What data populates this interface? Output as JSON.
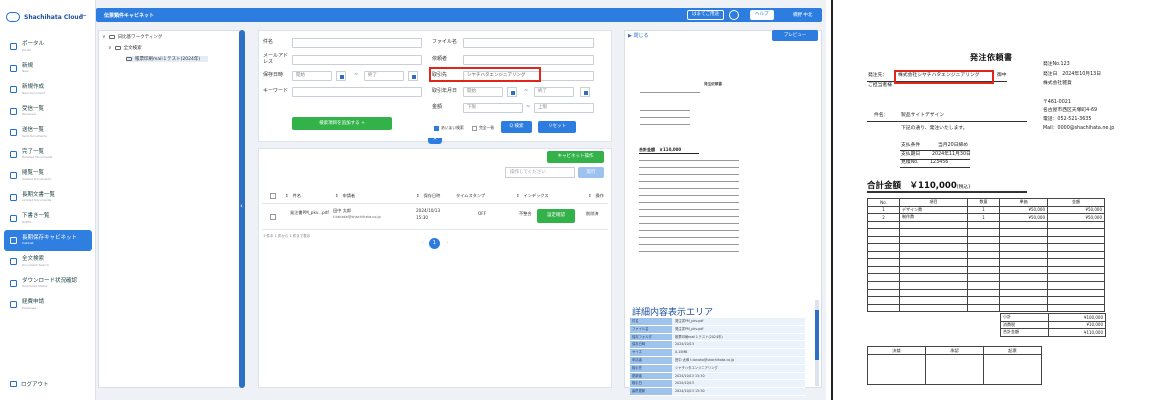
{
  "app": {
    "brand": "Shachihata Cloud",
    "topbar_title": "伝票類件キャビネット",
    "topbar_buttons": [
      "はまてご用途",
      "ヘルプ"
    ],
    "user": "橋野 中北"
  },
  "sidebar": {
    "items": [
      {
        "label": "ポータル",
        "sub": "Portal"
      },
      {
        "label": "新規",
        "sub": "New"
      },
      {
        "label": "新規作成",
        "sub": "New Document"
      },
      {
        "label": "受信一覧",
        "sub": "Received"
      },
      {
        "label": "送信一覧",
        "sub": "Sent Documents"
      },
      {
        "label": "完了一覧",
        "sub": "Finished Documents"
      },
      {
        "label": "閲覧一覧",
        "sub": "Viewed Documents"
      },
      {
        "label": "長期文書一覧",
        "sub": "Limited Documents"
      },
      {
        "label": "下書き一覧",
        "sub": "Drafts"
      },
      {
        "label": "長期保存キャビネット",
        "sub": "Cabinet"
      },
      {
        "label": "全文検索",
        "sub": "Document Search"
      },
      {
        "label": "ダウンロード状況確認",
        "sub": "Download Status"
      },
      {
        "label": "経費申請",
        "sub": "Expenses"
      }
    ],
    "logout": "ログアウト"
  },
  "tree": {
    "root": "日比基ワークティング",
    "folder": "全文検索",
    "selected": "帳票印刷mail１テスト(2024年)"
  },
  "search_form": {
    "name_label": "件名",
    "filename_label": "ファイル名",
    "email_label": "メールアドレス",
    "sender_label": "依頼者",
    "saved_date_label": "保存日時",
    "date_from": "開始",
    "date_to": "終了",
    "partner_label": "取引先",
    "partner_value": "シヤチハタエンジニアリング",
    "keyword_label": "キーワード",
    "txn_date_label": "取引年月日",
    "amount_label": "金額",
    "amount_min": "下限",
    "amount_max": "上限",
    "add_condition": "検索項目を追加する +",
    "chk_exact": "あいまい検索",
    "chk_all": "完全一致",
    "search_btn": "Q 検索",
    "reset_btn": "リセット"
  },
  "results": {
    "bulk_btn": "キャビネット操作",
    "select_placeholder": "操作してください",
    "exec_btn": "実行",
    "headers": [
      "件名",
      "申請者",
      "保存日時",
      "タイムスタンプ",
      "インデックス",
      "操作"
    ],
    "rows": [
      {
        "name": "発注書PM_pkv...pdf",
        "applicant": "田中 太郎",
        "applicant_email": "t.tanaka@shachihata.co.jp",
        "date": "2024/10/13",
        "time": "15:30",
        "timestamp": "OFF",
        "index_status": "不整合",
        "index_btn": "設定確認",
        "action": "削除済"
      }
    ],
    "pager_note": "1 件中 1 件から 1 件まで表示",
    "page": "1"
  },
  "preview": {
    "close": "閉じる",
    "preview_btn": "プレビュー",
    "detail_title": "詳細内容表示エリア",
    "mini_title": "発注依頼書",
    "mini_total": "合計金額　￥110,000",
    "details": [
      {
        "k": "件名",
        "v": "発注書PM_pkv.pdf"
      },
      {
        "k": "ファイル名",
        "v": "発注書PM_pkv.pdf"
      },
      {
        "k": "保存フォルダ",
        "v": "帳票印刷mail１テスト(2024年)"
      },
      {
        "k": "保存日時",
        "v": "2024/10/13"
      },
      {
        "k": "サイズ",
        "v": "0.15MB"
      },
      {
        "k": "申請者",
        "v": "田中 太郎 t.tanaka@shachihata.co.jp"
      },
      {
        "k": "取引先",
        "v": "シヤチハタエンジニアリング"
      },
      {
        "k": "更新者",
        "v": "2024/10/13 15:30"
      },
      {
        "k": "取引日",
        "v": "2024/10/13"
      },
      {
        "k": "最終更新",
        "v": "2024/10/13 15:30"
      }
    ]
  },
  "document": {
    "title": "発注依頼書",
    "to_label": "発注先：",
    "to_name": "株式会社シヤチハタエンジニアリング",
    "to_suffix": "御中",
    "responsible": "ご担当者様",
    "order_no": "発注No.123",
    "order_date": "発注日　2024年10月13日",
    "company": "株式会社雑貨",
    "zip": "〒461-0021",
    "address": "名古屋市西区天塚町4-69",
    "tel": "電話：052-521-3635",
    "mail": "Mail：0000@shachihata.ne.jp",
    "subject_label": "件名：",
    "subject": "製品サイトデザイン",
    "intro": "下記の通り、発注いたします。",
    "pay_terms_label": "支払条件",
    "pay_terms": "当月20日締め",
    "pay_due_label": "支払期日",
    "pay_due": "2024年11月30日",
    "estimate_label": "見積No.",
    "estimate_no": "123456",
    "total_label": "合計金額",
    "total_amount": "￥110,000",
    "total_tax": "(税込)",
    "items_headers": [
      "No.",
      "項目",
      "数量",
      "単価",
      "金額"
    ],
    "items": [
      {
        "no": "1",
        "name": "デザイン費",
        "qty": "1",
        "price": "¥50,000",
        "amount": "¥50,000"
      },
      {
        "no": "2",
        "name": "制作費",
        "qty": "1",
        "price": "¥50,000",
        "amount": "¥50,000"
      }
    ],
    "subtotal_label": "小計",
    "subtotal": "¥100,000",
    "tax_label": "消費税",
    "tax": "¥10,000",
    "grand_label": "合計金額",
    "grand": "¥110,000",
    "stamps": [
      "決裁",
      "承認",
      "起票"
    ]
  }
}
